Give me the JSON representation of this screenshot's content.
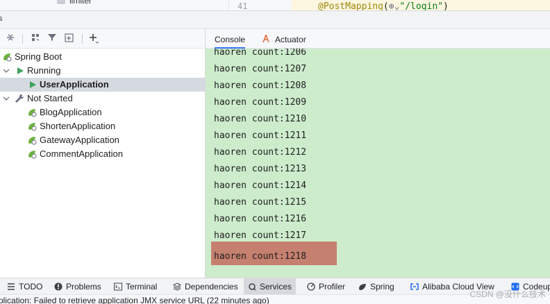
{
  "top_strip": {
    "tree_fragment": "limiter",
    "line_number": "41",
    "annotation": "@PostMapping",
    "code_rest_open": "(",
    "code_string": "\"/login\"",
    "code_rest_close": ")"
  },
  "tool_window": {
    "title_fragment": "s"
  },
  "tree": {
    "root": "Spring Boot",
    "running_group": "Running",
    "running_items": [
      "UserApplication"
    ],
    "not_started_group": "Not Started",
    "not_started_items": [
      "BlogApplication",
      "ShortenApplication",
      "GatewayApplication",
      "CommentApplication"
    ]
  },
  "tabs": {
    "console": "Console",
    "actuator": "Actuator"
  },
  "console": {
    "lines": [
      "haoren count:1206",
      "haoren count:1207",
      "haoren count:1208",
      "haoren count:1209",
      "haoren count:1210",
      "haoren count:1211",
      "haoren count:1212",
      "haoren count:1213",
      "haoren count:1214",
      "haoren count:1215",
      "haoren count:1216",
      "haoren count:1217",
      "haoren count:1218"
    ],
    "highlight_color": "#c6806f",
    "background_color": "#cdeccc"
  },
  "bottom_bar": {
    "items": [
      "TODO",
      "Problems",
      "Terminal",
      "Dependencies",
      "Services",
      "Profiler",
      "Spring",
      "Alibaba Cloud View",
      "Codeup"
    ],
    "active": "Services"
  },
  "status_bar": {
    "text": "plication: Failed to retrieve application JMX service URL (22 minutes ago)"
  },
  "watermark": "CSDN @没什么技术",
  "colors": {
    "accent": "#3574f0",
    "run_green": "#3fa35b",
    "selection": "#d5d9e0"
  }
}
